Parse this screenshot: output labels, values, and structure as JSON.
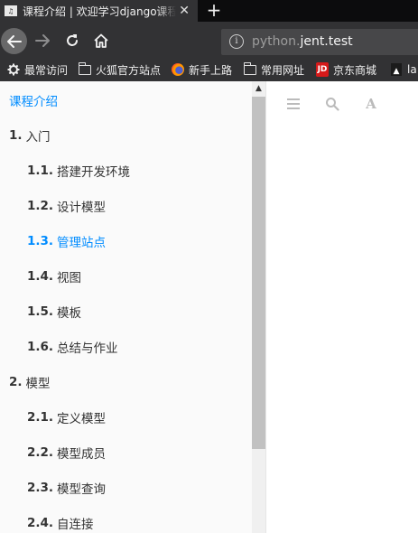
{
  "browser": {
    "tab": {
      "title": "课程介绍 | 欢迎学习django课程"
    },
    "new_tab_label": "+",
    "url": {
      "prefix": "python.",
      "domain": "jent.test"
    },
    "bookmarks": [
      {
        "label": "最常访问",
        "icon": "gear-icon"
      },
      {
        "label": "火狐官方站点",
        "icon": "folder-icon"
      },
      {
        "label": "新手上路",
        "icon": "firefox-icon"
      },
      {
        "label": "常用网址",
        "icon": "folder-icon"
      },
      {
        "label": "京东商城",
        "icon": "jd-icon"
      },
      {
        "label": "la",
        "icon": "bookmark-icon"
      }
    ]
  },
  "book": {
    "toolbar": {
      "font_label": "A"
    },
    "toc": [
      {
        "num": "",
        "label": "课程介绍",
        "active": true
      },
      {
        "num": "1.",
        "label": "入门",
        "level": 1
      },
      {
        "num": "1.1.",
        "label": "搭建开发环境",
        "level": 2
      },
      {
        "num": "1.2.",
        "label": "设计模型",
        "level": 2
      },
      {
        "num": "1.3.",
        "label": "管理站点",
        "level": 2,
        "active": true
      },
      {
        "num": "1.4.",
        "label": "视图",
        "level": 2
      },
      {
        "num": "1.5.",
        "label": "模板",
        "level": 2
      },
      {
        "num": "1.6.",
        "label": "总结与作业",
        "level": 2
      },
      {
        "num": "2.",
        "label": "模型",
        "level": 1
      },
      {
        "num": "2.1.",
        "label": "定义模型",
        "level": 2
      },
      {
        "num": "2.2.",
        "label": "模型成员",
        "level": 2
      },
      {
        "num": "2.3.",
        "label": "模型查询",
        "level": 2
      },
      {
        "num": "2.4.",
        "label": "自连接",
        "level": 2
      }
    ],
    "colors": {
      "active": "#008cff",
      "text": "#333333",
      "sidebar_bg": "#fafafa"
    }
  }
}
